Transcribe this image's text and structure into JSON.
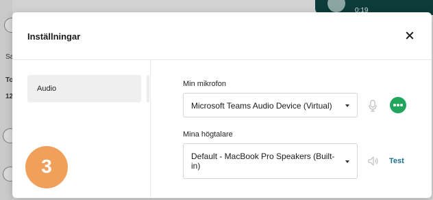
{
  "background": {
    "left_fragments": [
      "Sa",
      "To",
      "12"
    ],
    "call_timer": "0:19"
  },
  "modal": {
    "title": "Inställningar",
    "close_icon": "close-icon"
  },
  "sidebar": {
    "items": [
      {
        "label": "Audio",
        "selected": true
      }
    ]
  },
  "step_badge": {
    "label": "3",
    "color": "#f0a05a"
  },
  "audio": {
    "microphone": {
      "label": "Min mikrofon",
      "value": "Microsoft Teams Audio Device (Virtual)",
      "icon": "microphone-icon",
      "level_icon": "more-dots-icon",
      "level_color": "#21a55c"
    },
    "speakers": {
      "label": "Mina högtalare",
      "value": "Default - MacBook Pro Speakers (Built-in)",
      "icon": "speaker-icon",
      "test_label": "Test",
      "test_color": "#1a6f8f"
    }
  }
}
